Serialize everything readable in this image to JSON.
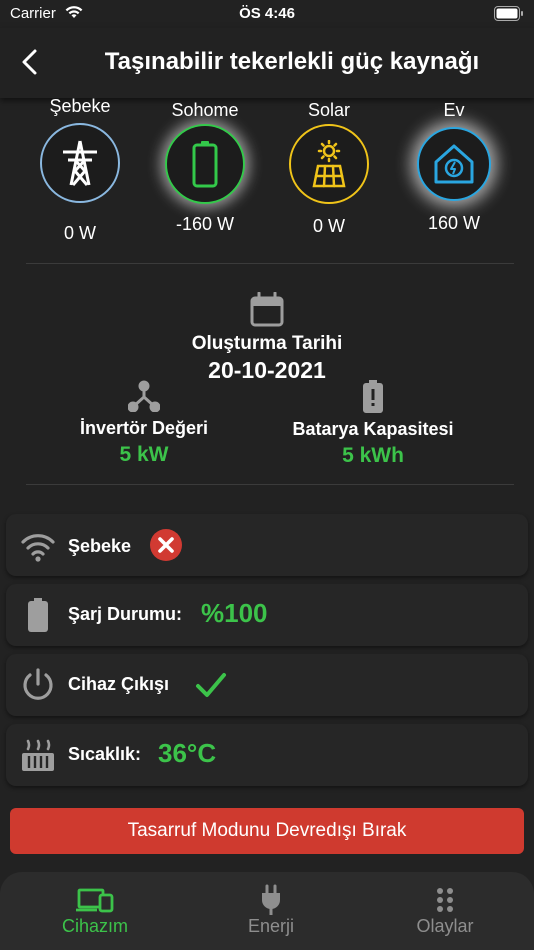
{
  "status_bar": {
    "carrier": "Carrier",
    "time": "ÖS 4:46"
  },
  "header": {
    "title": "Taşınabilir tekerlekli güç kaynağı"
  },
  "flow": {
    "nodes": [
      {
        "label": "Şebeke",
        "value": "0 W",
        "ring_color": "#8ab8e0",
        "icon": "transmission-tower-icon"
      },
      {
        "label": "Sohome",
        "value": "-160 W",
        "ring_color": "#33c94a",
        "icon": "battery-icon"
      },
      {
        "label": "Solar",
        "value": "0 W",
        "ring_color": "#f0c419",
        "icon": "solar-panel-icon"
      },
      {
        "label": "Ev",
        "value": "160 W",
        "ring_color": "#2aa6e0",
        "icon": "smart-home-icon"
      }
    ]
  },
  "device_info": {
    "created_label": "Oluşturma Tarihi",
    "created_date": "20-10-2021",
    "inverter_label": "İnvertör Değeri",
    "inverter_value": "5 kW",
    "battery_label": "Batarya Kapasitesi",
    "battery_value": "5 kWh"
  },
  "status_rows": {
    "grid_label": "Şebeke",
    "charge_label": "Şarj Durumu:",
    "charge_value": "%100",
    "output_label": "Cihaz Çıkışı",
    "temp_label": "Sıcaklık:",
    "temp_value": "36°C"
  },
  "action": {
    "label": "Tasarruf Modunu Devredışı Bırak"
  },
  "tabs": [
    {
      "label": "Cihazım",
      "active": true
    },
    {
      "label": "Enerji",
      "active": false
    },
    {
      "label": "Olaylar",
      "active": false
    }
  ],
  "colors": {
    "accent_green": "#3cc34a",
    "danger_red": "#cf3a2f",
    "inactive_gray": "#8e8e8e"
  }
}
